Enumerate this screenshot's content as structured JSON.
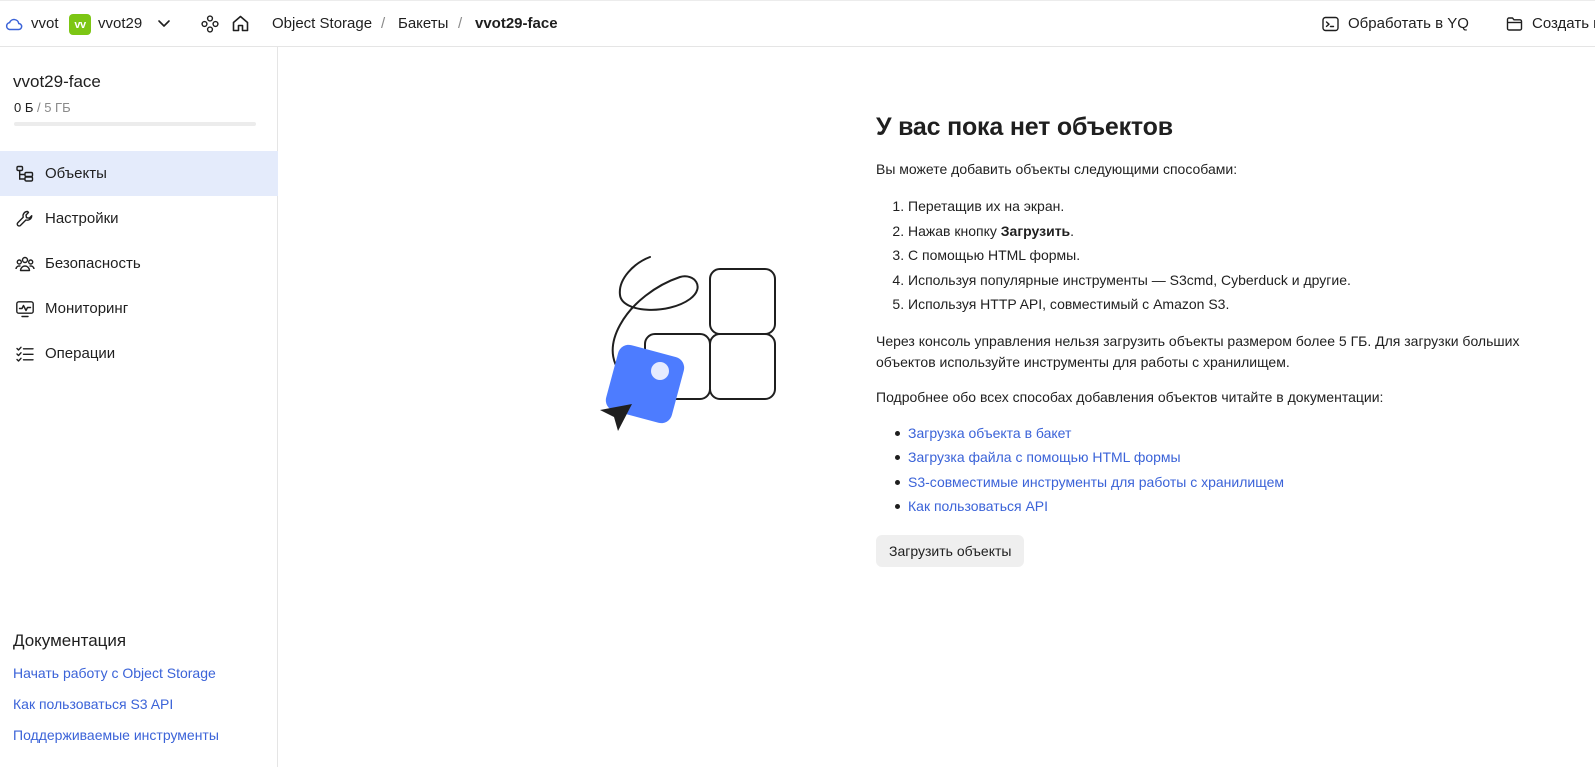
{
  "topbar": {
    "cloud_name": "vvot",
    "folder_badge": "vv",
    "folder_name": "vvot29",
    "breadcrumbs": [
      "Object Storage",
      "Бакеты",
      "vvot29-face"
    ],
    "separator": "/",
    "actions": [
      "Обработать в YQ",
      "Создать п"
    ]
  },
  "sidebar": {
    "bucket_name": "vvot29-face",
    "usage": {
      "used": "0 Б",
      "separator": " / ",
      "total": "5 ГБ",
      "fraction": 0
    },
    "nav_items": [
      {
        "label": "Объекты",
        "icon": "objects-tree-icon",
        "active": true
      },
      {
        "label": "Настройки",
        "icon": "wrench-icon",
        "active": false
      },
      {
        "label": "Безопасность",
        "icon": "users-icon",
        "active": false
      },
      {
        "label": "Мониторинг",
        "icon": "monitor-chart-icon",
        "active": false
      },
      {
        "label": "Операции",
        "icon": "list-check-icon",
        "active": false
      }
    ],
    "docs": {
      "title": "Документация",
      "links": [
        "Начать работу с Object Storage",
        "Как пользоваться S3 API",
        "Поддерживаемые инструменты"
      ]
    }
  },
  "main": {
    "title": "У вас пока нет объектов",
    "intro": "Вы можете добавить объекты следующими способами:",
    "steps": [
      {
        "text": "Перетащив их на экран.",
        "bold": ""
      },
      {
        "text": "Нажав кнопку ",
        "bold": "Загрузить",
        "after": "."
      },
      {
        "text": "С помощью HTML формы.",
        "bold": ""
      },
      {
        "text": "Используя популярные инструменты — S3cmd, Cyberduck и другие.",
        "bold": ""
      },
      {
        "text": "Используя HTTP API, совместимый с Amazon S3.",
        "bold": ""
      }
    ],
    "note": "Через консоль управления нельзя загрузить объекты размером более 5 ГБ. Для загрузки больших объектов используйте инструменты для работы с хранилищем.",
    "docs_intro": "Подробнее обо всех способах добавления объектов читайте в документации:",
    "doc_links": [
      "Загрузка объекта в бакет",
      "Загрузка файла с помощью HTML формы",
      "S3-совместимые инструменты для работы с хранилищем",
      "Как пользоваться API"
    ],
    "upload_button": "Загрузить объекты"
  },
  "colors": {
    "accent": "#3b63d8",
    "active_nav_bg": "#e4ebfb",
    "folder_badge": "#7cc614",
    "illustration_blue": "#4d7cff"
  }
}
